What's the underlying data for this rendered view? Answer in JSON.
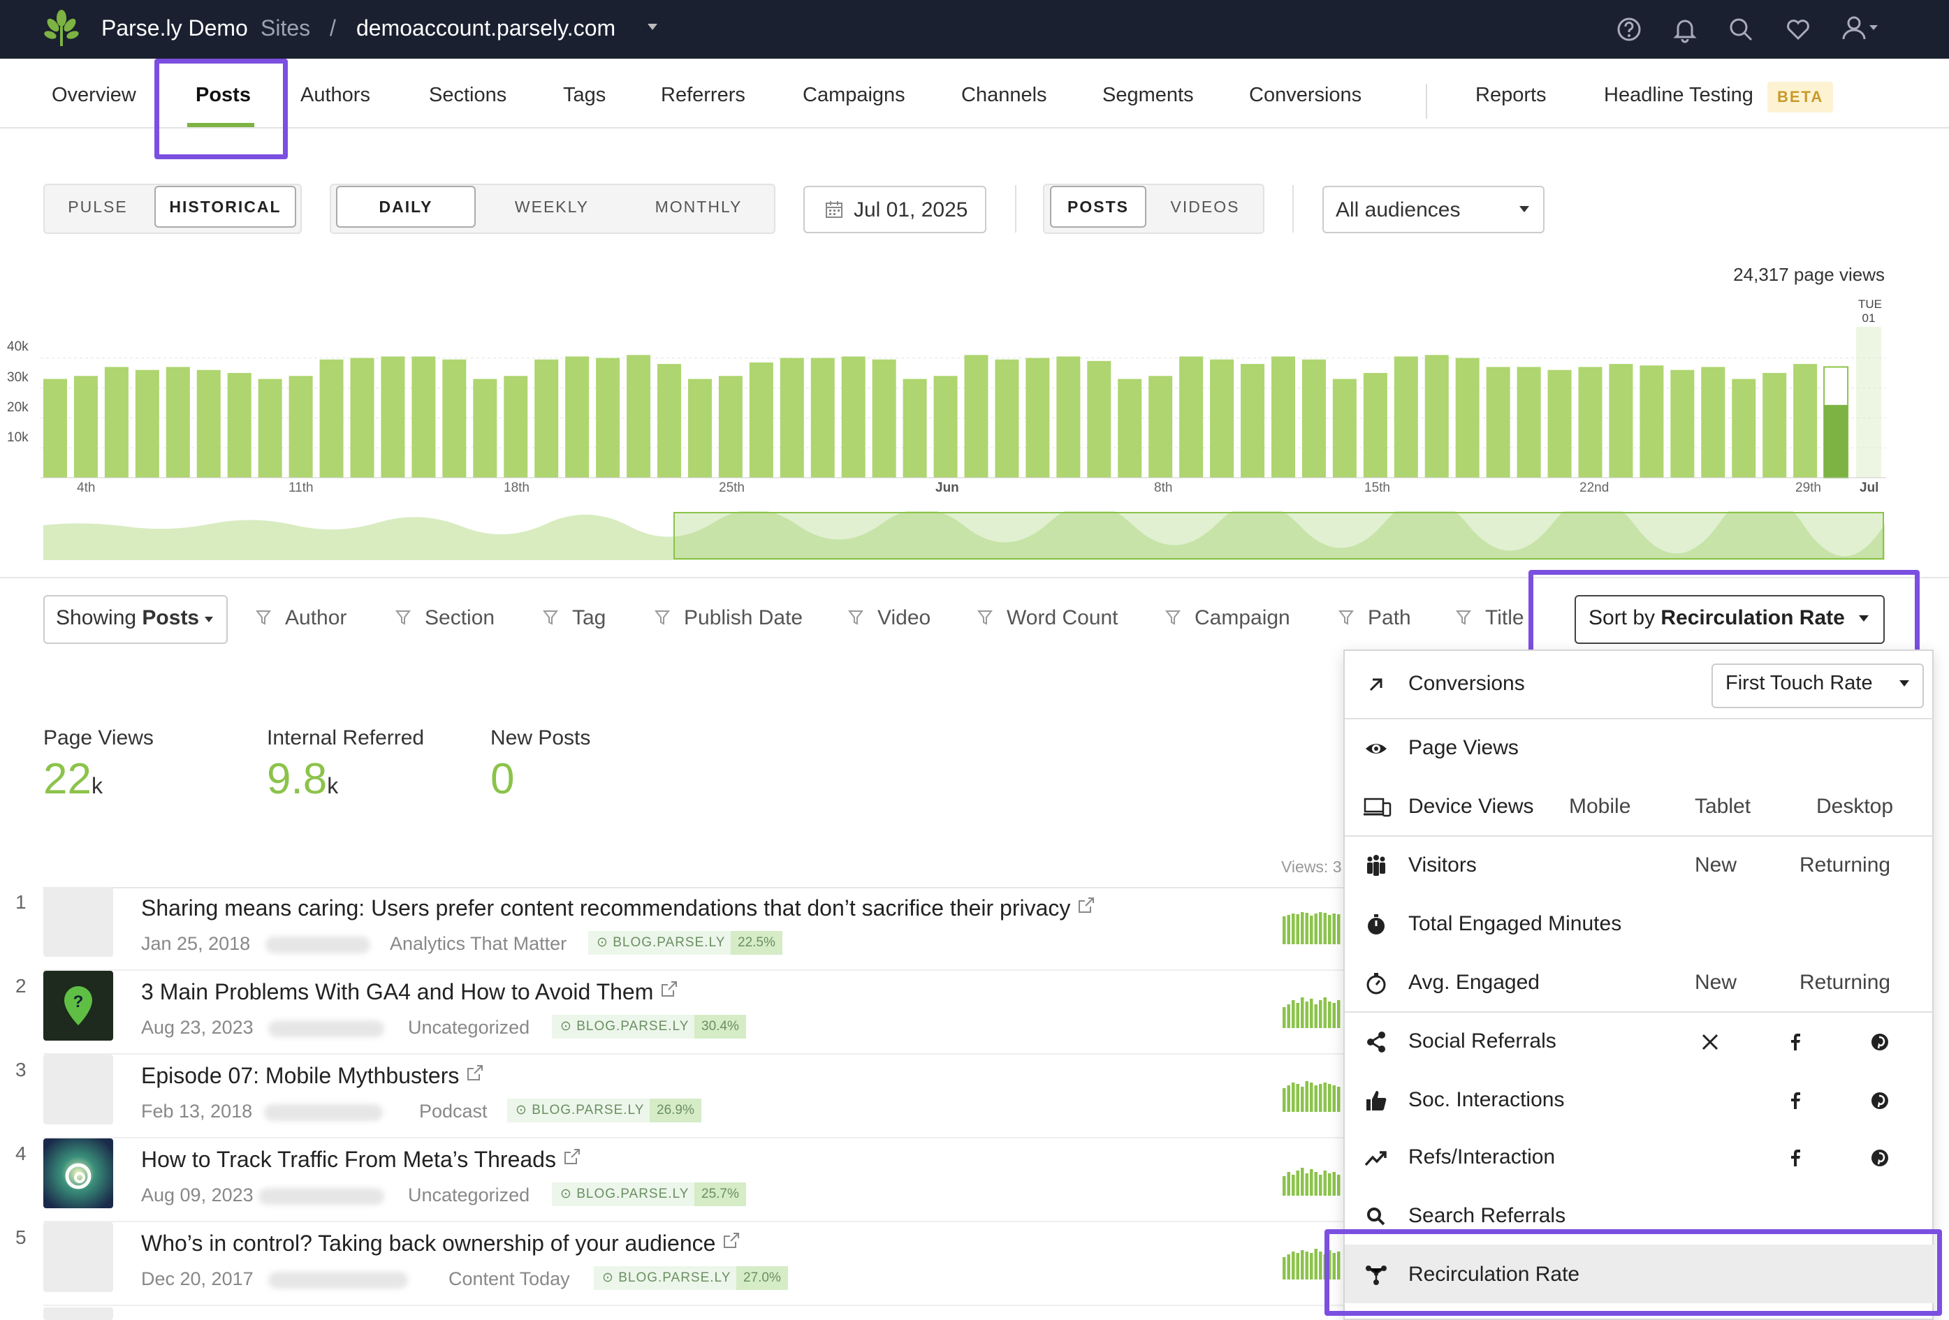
{
  "topbar": {
    "brand": "Parse.ly Demo",
    "sites": "Sites",
    "slash": "/",
    "domain": "demoaccount.parsely.com"
  },
  "nav": {
    "items": [
      "Overview",
      "Posts",
      "Authors",
      "Sections",
      "Tags",
      "Referrers",
      "Campaigns",
      "Channels",
      "Segments",
      "Conversions",
      "Reports",
      "Headline Testing"
    ],
    "active": "Posts",
    "beta": "BETA"
  },
  "controls": {
    "mode": [
      "PULSE",
      "HISTORICAL"
    ],
    "period": [
      "DAILY",
      "WEEKLY",
      "MONTHLY"
    ],
    "date": "Jul 01, 2025",
    "content": [
      "POSTS",
      "VIDEOS"
    ],
    "audience": "All audiences"
  },
  "chart_data": {
    "type": "bar",
    "title": "24,317 page views",
    "highlight_label": [
      "TUE",
      "01"
    ],
    "yticks": [
      "40k",
      "30k",
      "20k",
      "10k"
    ],
    "xticks": [
      "4th",
      "11th",
      "18th",
      "25th",
      "Jun",
      "8th",
      "15th",
      "22nd",
      "29th",
      "Jul"
    ],
    "ylim": [
      0,
      42000
    ],
    "values": [
      33000,
      34000,
      37000,
      36000,
      37000,
      36000,
      35000,
      33000,
      34000,
      39500,
      40000,
      40500,
      40500,
      39500,
      33000,
      34000,
      39500,
      40500,
      40000,
      41000,
      38000,
      33000,
      34000,
      38500,
      40000,
      40000,
      40500,
      39500,
      33000,
      34000,
      41000,
      39500,
      40000,
      40500,
      39000,
      33000,
      34000,
      40500,
      39500,
      38000,
      40500,
      39500,
      33000,
      35000,
      40500,
      41000,
      40000,
      37000,
      37000,
      36000,
      37000,
      38000,
      37500,
      36000,
      37000,
      33000,
      35000,
      38000
    ],
    "last_value": 24317,
    "last_series": "current day"
  },
  "filters": {
    "showing_prefix": "Showing",
    "showing_value": "Posts",
    "items": [
      "Author",
      "Section",
      "Tag",
      "Publish Date",
      "Video",
      "Word Count",
      "Campaign",
      "Path",
      "Title"
    ],
    "sort_prefix": "Sort by",
    "sort_value": "Recirculation Rate"
  },
  "metrics": [
    {
      "label": "Page Views",
      "value": "22",
      "unit": "k"
    },
    {
      "label": "Internal Referred",
      "value": "9.8",
      "unit": "k"
    },
    {
      "label": "New Posts",
      "value": "0",
      "unit": ""
    }
  ],
  "views_label": "Views: 3",
  "posts": [
    {
      "rank": "1",
      "title": "Sharing means caring: Users prefer content recommendations that don’t sacrifice their privacy",
      "date": "Jan 25, 2018",
      "section": "Analytics That Matter",
      "badge": "BLOG.PARSE.LY",
      "pct": "22.5%"
    },
    {
      "rank": "2",
      "title": "3 Main Problems With GA4 and How to Avoid Them",
      "date": "Aug 23, 2023",
      "section": "Uncategorized",
      "badge": "BLOG.PARSE.LY",
      "pct": "30.4%"
    },
    {
      "rank": "3",
      "title": "Episode 07: Mobile Mythbusters",
      "date": "Feb 13, 2018",
      "section": "Podcast",
      "badge": "BLOG.PARSE.LY",
      "pct": "26.9%"
    },
    {
      "rank": "4",
      "title": "How to Track Traffic From Meta’s Threads",
      "date": "Aug 09, 2023",
      "section": "Uncategorized",
      "badge": "BLOG.PARSE.LY",
      "pct": "25.7%"
    },
    {
      "rank": "5",
      "title": "Who’s in control? Taking back ownership of your audience",
      "date": "Dec 20, 2017",
      "section": "Content Today",
      "badge": "BLOG.PARSE.LY",
      "pct": "27.0%"
    }
  ],
  "sort_menu": {
    "conversions": "Conversions",
    "conversion_type": "First Touch Rate",
    "page_views": "Page Views",
    "device_views": "Device Views",
    "device_sub": [
      "Mobile",
      "Tablet",
      "Desktop"
    ],
    "visitors": "Visitors",
    "visitors_sub": [
      "New",
      "Returning"
    ],
    "total_engaged": "Total Engaged Minutes",
    "avg_engaged": "Avg. Engaged",
    "avg_sub": [
      "New",
      "Returning"
    ],
    "social_referrals": "Social Referrals",
    "soc_interactions": "Soc. Interactions",
    "refs_interaction": "Refs/Interaction",
    "search_referrals": "Search Referrals",
    "recirculation": "Recirculation Rate"
  },
  "colors": {
    "accent": "#8bc34a",
    "highlight": "#7b4fe0",
    "topbar": "#1a2030"
  }
}
